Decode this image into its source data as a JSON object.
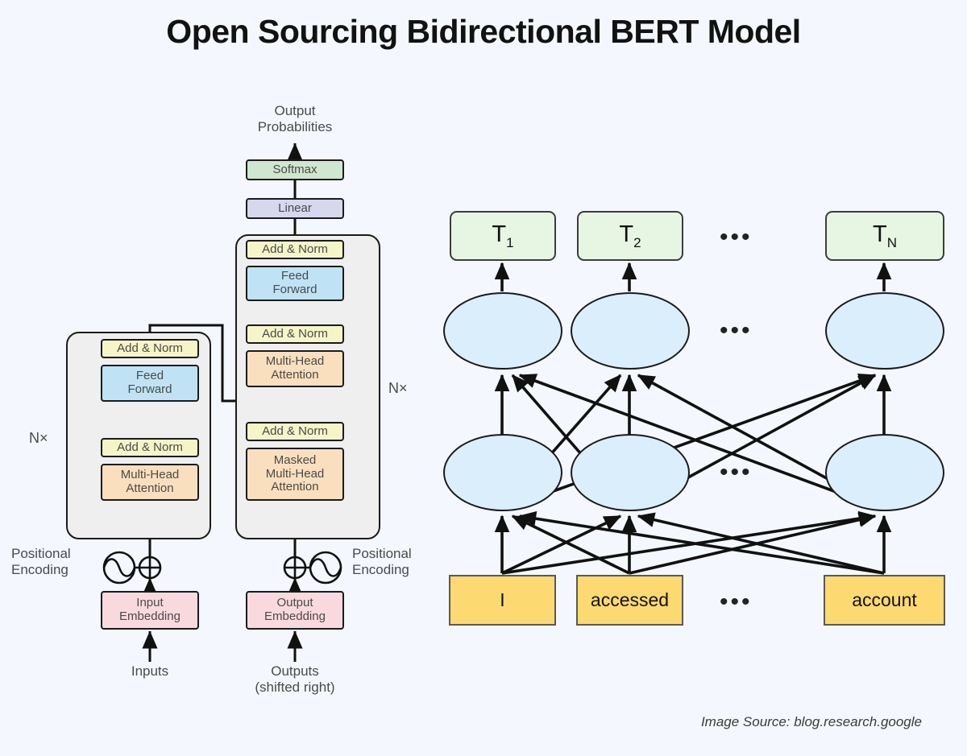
{
  "page": {
    "title": "Open Sourcing Bidirectional BERT Model",
    "background_color": "#f4f8fe",
    "credit": "Image Source: blog.research.google"
  },
  "transformer_diagram": {
    "name": "transformer-architecture",
    "top_label": "Output\nProbabilities",
    "blocks": {
      "softmax": "Softmax",
      "linear": "Linear",
      "add_norm": "Add & Norm",
      "feed_forward": "Feed\nForward",
      "multi_head_attention": "Multi-Head\nAttention",
      "masked_multi_head_attention": "Masked\nMulti-Head\nAttention",
      "input_embedding": "Input\nEmbedding",
      "output_embedding": "Output\nEmbedding"
    },
    "labels": {
      "positional_encoding_left": "Positional\nEncoding",
      "positional_encoding_right": "Positional\nEncoding",
      "inputs": "Inputs",
      "outputs": "Outputs\n(shifted right)",
      "nx_encoder": "N×",
      "nx_decoder": "N×"
    },
    "colors": {
      "softmax": "#cfe7cf",
      "linear": "#d6d8ee",
      "add_norm": "#f5f5c8",
      "feed_forward": "#bfe3f5",
      "attention": "#fadfbe",
      "embedding": "#f8dade",
      "stack_bg": "#f0efef",
      "stroke": "#1b1b1b"
    }
  },
  "bert_diagram": {
    "name": "bidirectional-bert",
    "outputs": [
      {
        "label": "T",
        "sub": "1"
      },
      {
        "label": "T",
        "sub": "2"
      },
      {
        "label": "T",
        "sub": "N"
      }
    ],
    "inputs": [
      {
        "word": "I"
      },
      {
        "word": "accessed"
      },
      {
        "word": "account"
      }
    ],
    "ellipsis": "•••",
    "layers": 2,
    "colors": {
      "output_box": "#e7f5e3",
      "input_box": "#fcd971",
      "node": "#daeffb",
      "stroke": "#1b1b1b"
    }
  }
}
